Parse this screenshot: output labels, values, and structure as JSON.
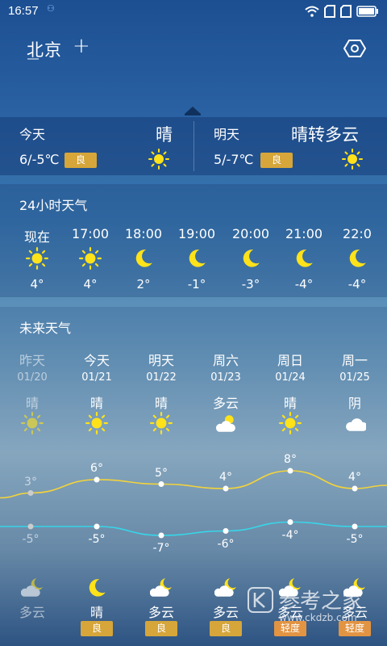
{
  "status": {
    "time": "16:57"
  },
  "header": {
    "city": "北京",
    "add_symbol": "+"
  },
  "today": {
    "label": "今天",
    "condition": "晴",
    "temp": "6/-5℃",
    "aqi": "良"
  },
  "tomorrow": {
    "label": "明天",
    "condition": "晴转多云",
    "temp": "5/-7℃",
    "aqi": "良"
  },
  "hourly": {
    "title": "24小时天气",
    "items": [
      {
        "time": "现在",
        "icon": "sun-icon",
        "temp": "4°"
      },
      {
        "time": "17:00",
        "icon": "sun-icon",
        "temp": "4°"
      },
      {
        "time": "18:00",
        "icon": "moon-icon",
        "temp": "2°"
      },
      {
        "time": "19:00",
        "icon": "moon-icon",
        "temp": "-1°"
      },
      {
        "time": "20:00",
        "icon": "moon-icon",
        "temp": "-3°"
      },
      {
        "time": "21:00",
        "icon": "moon-icon",
        "temp": "-4°"
      },
      {
        "time": "22:0",
        "icon": "moon-icon",
        "temp": "-4°"
      }
    ]
  },
  "forecast": {
    "title": "未来天气",
    "days": [
      {
        "day": "昨天",
        "date": "01/20",
        "cond": "晴",
        "icon": "sun-icon",
        "high": "3°",
        "low": "-5°",
        "night_icon": "cloudy-moon-icon",
        "night_cond": "多云",
        "aqi": ""
      },
      {
        "day": "今天",
        "date": "01/21",
        "cond": "晴",
        "icon": "sun-icon",
        "high": "6°",
        "low": "-5°",
        "night_icon": "moon-icon",
        "night_cond": "晴",
        "aqi": "良"
      },
      {
        "day": "明天",
        "date": "01/22",
        "cond": "晴",
        "icon": "sun-icon",
        "high": "5°",
        "low": "-7°",
        "night_icon": "cloudy-moon-icon",
        "night_cond": "多云",
        "aqi": "良"
      },
      {
        "day": "周六",
        "date": "01/23",
        "cond": "多云",
        "icon": "cloudy-sun-icon",
        "high": "4°",
        "low": "-6°",
        "night_icon": "cloudy-moon-icon",
        "night_cond": "多云",
        "aqi": "良"
      },
      {
        "day": "周日",
        "date": "01/24",
        "cond": "晴",
        "icon": "sun-icon",
        "high": "8°",
        "low": "-4°",
        "night_icon": "cloudy-moon-icon",
        "night_cond": "多云",
        "aqi": "轻度"
      },
      {
        "day": "周一",
        "date": "01/25",
        "cond": "阴",
        "icon": "cloud-icon",
        "high": "4°",
        "low": "-5°",
        "night_icon": "cloudy-moon-icon",
        "night_cond": "多云",
        "aqi": "轻度"
      }
    ],
    "high_values": [
      3,
      6,
      5,
      4,
      8,
      4
    ],
    "low_values": [
      -5,
      -5,
      -7,
      -6,
      -4,
      -5
    ]
  },
  "watermark": {
    "brand": "参考之家",
    "url": "www.ckdzb.com"
  },
  "colors": {
    "high_line": "#f2d33b",
    "low_line": "#37d6e8",
    "sun": "#ffe21a",
    "badge_good": "#d6a63a",
    "badge_light": "#e29443"
  }
}
